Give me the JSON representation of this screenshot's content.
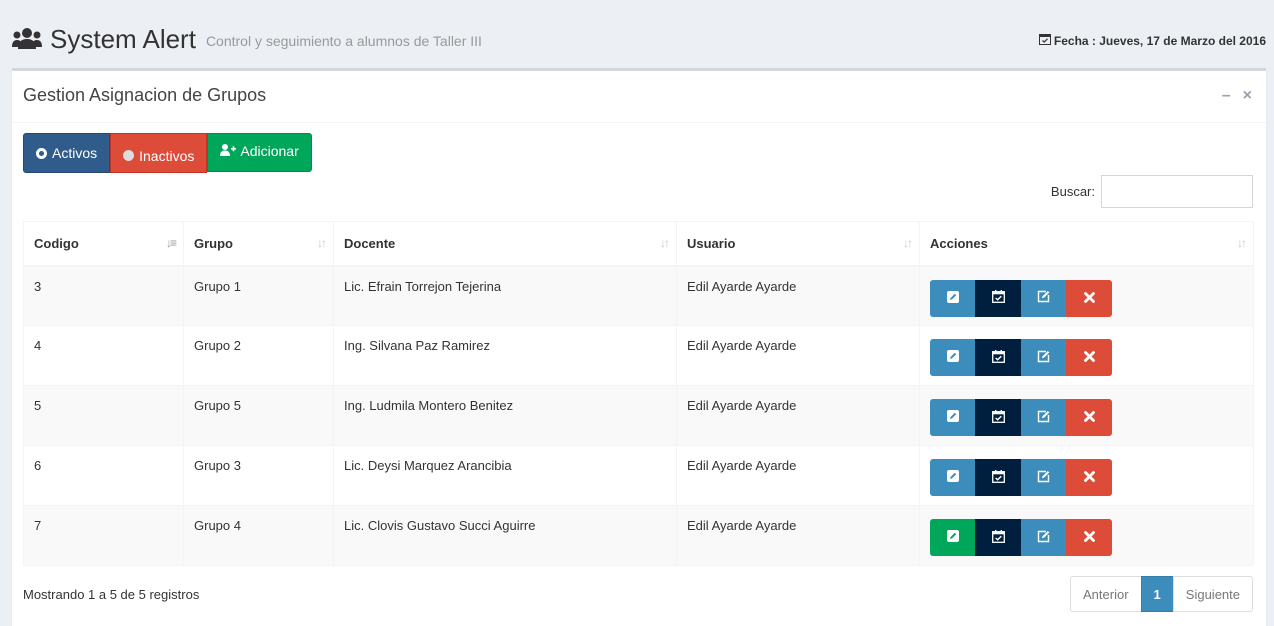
{
  "header": {
    "title": "System Alert",
    "subtitle": "Control y seguimiento a alumnos de Taller III",
    "date": "Fecha : Jueves, 17 de Marzo del 2016"
  },
  "box": {
    "title": "Gestion Asignacion de Grupos",
    "minimize": "–",
    "close": "×"
  },
  "filters": {
    "activos_label": "Activos",
    "inactivos_label": "Inactivos",
    "add_label": "Adicionar"
  },
  "search": {
    "label": "Buscar:",
    "value": ""
  },
  "table": {
    "columns": [
      "Codigo",
      "Grupo",
      "Docente",
      "Usuario",
      "Acciones"
    ],
    "rows": [
      {
        "codigo": "3",
        "grupo": "Grupo 1",
        "docente": "Lic. Efrain Torrejon Tejerina",
        "usuario": "Edil Ayarde Ayarde",
        "first_action": "blue"
      },
      {
        "codigo": "4",
        "grupo": "Grupo 2",
        "docente": "Ing. Silvana Paz Ramirez",
        "usuario": "Edil Ayarde Ayarde",
        "first_action": "blue"
      },
      {
        "codigo": "5",
        "grupo": "Grupo 5",
        "docente": "Ing. Ludmila Montero Benitez",
        "usuario": "Edil Ayarde Ayarde",
        "first_action": "blue"
      },
      {
        "codigo": "6",
        "grupo": "Grupo 3",
        "docente": "Lic. Deysi Marquez Arancibia",
        "usuario": "Edil Ayarde Ayarde",
        "first_action": "blue"
      },
      {
        "codigo": "7",
        "grupo": "Grupo 4",
        "docente": "Lic. Clovis Gustavo Succi Aguirre",
        "usuario": "Edil Ayarde Ayarde",
        "first_action": "green"
      }
    ]
  },
  "footer": {
    "info": "Mostrando 1 a 5 de 5 registros",
    "prev": "Anterior",
    "page": "1",
    "next": "Siguiente"
  },
  "colors": {
    "primary": "#3c8dbc",
    "navy": "#001f3f",
    "danger": "#dd4b39",
    "success": "#00a65a",
    "activos": "#2f5c8b"
  }
}
